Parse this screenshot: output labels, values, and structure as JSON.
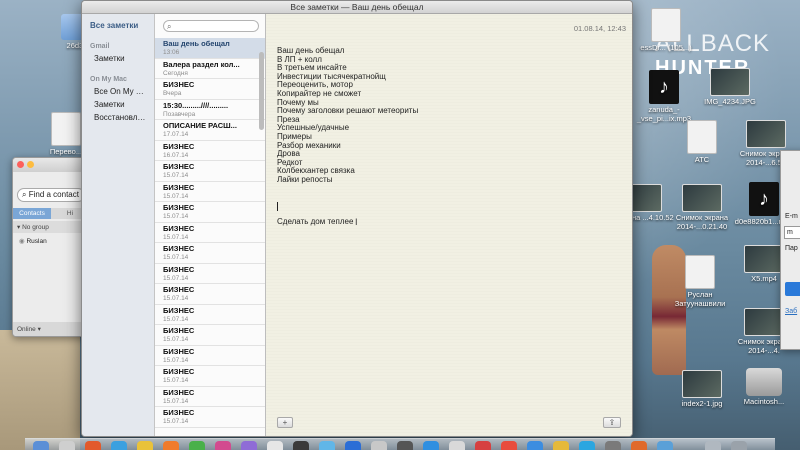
{
  "window": {
    "title": "Все заметки — Ваш день обещал"
  },
  "sidebar": {
    "all_notes": "Все заметки",
    "sections": [
      {
        "header": "Gmail",
        "items": [
          "Заметки"
        ]
      },
      {
        "header": "On My Mac",
        "items": [
          "Все On My Mac",
          "Заметки",
          "Восстановлен..."
        ]
      }
    ]
  },
  "note_list": {
    "search_placeholder": "",
    "notes": [
      {
        "title": "Ваш день обещал",
        "date": "13:06",
        "selected": true
      },
      {
        "title": "Валера раздел кол...",
        "date": "Сегодня"
      },
      {
        "title": "БИЗНЕС",
        "date": "Вчера"
      },
      {
        "title": "15:30.........////.........",
        "date": "Позавчера"
      },
      {
        "title": "ОПИСАНИЕ РАСШ...",
        "date": "17.07.14"
      },
      {
        "title": "БИЗНЕС",
        "date": "16.07.14"
      },
      {
        "title": "БИЗНЕС",
        "date": "15.07.14"
      },
      {
        "title": "БИЗНЕС",
        "date": "15.07.14"
      },
      {
        "title": "БИЗНЕС",
        "date": "15.07.14"
      },
      {
        "title": "БИЗНЕС",
        "date": "15.07.14"
      },
      {
        "title": "БИЗНЕС",
        "date": "15.07.14"
      },
      {
        "title": "БИЗНЕС",
        "date": "15.07.14"
      },
      {
        "title": "БИЗНЕС",
        "date": "15.07.14"
      },
      {
        "title": "БИЗНЕС",
        "date": "15.07.14"
      },
      {
        "title": "БИЗНЕС",
        "date": "15.07.14"
      },
      {
        "title": "БИЗНЕС",
        "date": "15.07.14"
      },
      {
        "title": "БИЗНЕС",
        "date": "15.07.14"
      },
      {
        "title": "БИЗНЕС",
        "date": "15.07.14"
      },
      {
        "title": "БИЗНЕС",
        "date": "15.07.14"
      }
    ]
  },
  "editor": {
    "date": "01.08.14, 12:43",
    "lines": [
      "Ваш день обещал",
      "В ЛП + колл",
      "В третьем инсайте",
      "Инвестиции тысячекратнойщ",
      "Переоценить, мотор",
      "Копирайтер не сможет",
      "Почему мы",
      "Почему заголовки решают метеориты",
      "Преза",
      "Успешные/удачные",
      "Примеры",
      "Разбор механики",
      "Дрова",
      "Редкот",
      "Колбекхантер связка",
      "Лайки репосты"
    ],
    "last_line": "Сделать дом теплее",
    "add_button": "+",
    "share_button": "⇪"
  },
  "contacts": {
    "search_placeholder": "Find a contact",
    "tabs": [
      "Contacts",
      "Hi"
    ],
    "group": "No group",
    "contact": "Ruslan",
    "status": "Online"
  },
  "desktop": {
    "watermark_line1": "ALLBACK",
    "watermark_line2": "HUNTER",
    "icons": [
      {
        "label": "26d3...",
        "kind": "folder"
      },
      {
        "label": "Перево...",
        "kind": "doc"
      },
      {
        "label": "essDr... (105...)",
        "kind": "doc"
      },
      {
        "label": "zanuda_-_vse_pi...ix.mp3",
        "kind": "music"
      },
      {
        "label": "IMG_4234.JPG",
        "kind": "photo"
      },
      {
        "label": "ATC",
        "kind": "doc"
      },
      {
        "label": "Снимок экрана 2014-...6.51",
        "kind": "photo"
      },
      {
        "label": "...экрана ...4.10.52",
        "kind": "photo"
      },
      {
        "label": "Снимок экрана 2014-...0.21.40",
        "kind": "photo"
      },
      {
        "label": "d0e8820b1...mp3",
        "kind": "music"
      },
      {
        "label": "Руслан Затуунашвили",
        "kind": "doc"
      },
      {
        "label": "X5.mp4",
        "kind": "photo"
      },
      {
        "label": "Снимок экрана 2014-...4.",
        "kind": "photo"
      },
      {
        "label": "index2-1.jpg",
        "kind": "photo"
      },
      {
        "label": "Macintosh...",
        "kind": "drive"
      }
    ]
  },
  "rightwin": {
    "rows": [
      "E-m",
      "m",
      "Пар"
    ],
    "link": "Заб"
  }
}
